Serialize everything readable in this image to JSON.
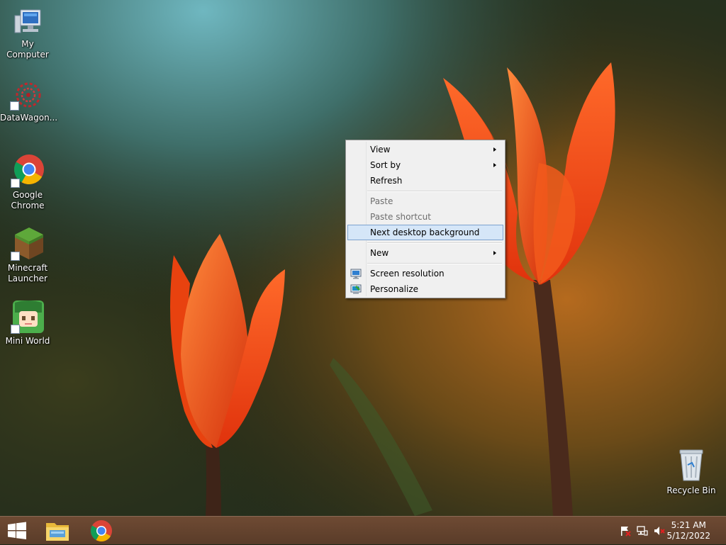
{
  "desktop": {
    "icons": [
      {
        "label": "My Computer",
        "icon": "computer-icon"
      },
      {
        "label": "DataWagon...",
        "icon": "datawagon-icon"
      },
      {
        "label": "Google Chrome",
        "icon": "chrome-icon"
      },
      {
        "label": "Minecraft Launcher",
        "icon": "minecraft-icon"
      },
      {
        "label": "Mini World",
        "icon": "miniworld-icon"
      },
      {
        "label": "Recycle Bin",
        "icon": "recycle-bin-icon"
      }
    ]
  },
  "context_menu": {
    "items": [
      {
        "label": "View",
        "submenu": true,
        "enabled": true
      },
      {
        "label": "Sort by",
        "submenu": true,
        "enabled": true
      },
      {
        "label": "Refresh",
        "submenu": false,
        "enabled": true
      },
      {
        "label": "Paste",
        "submenu": false,
        "enabled": false
      },
      {
        "label": "Paste shortcut",
        "submenu": false,
        "enabled": false
      },
      {
        "label": "Next desktop background",
        "submenu": false,
        "enabled": true,
        "highlighted": true
      },
      {
        "label": "New",
        "submenu": true,
        "enabled": true
      },
      {
        "label": "Screen resolution",
        "submenu": false,
        "enabled": true,
        "icon": "display-icon"
      },
      {
        "label": "Personalize",
        "submenu": false,
        "enabled": true,
        "icon": "personalize-icon"
      }
    ]
  },
  "taskbar": {
    "pinned": [
      "start-icon",
      "file-explorer-icon",
      "chrome-icon"
    ],
    "tray": [
      "action-center-flag-icon",
      "network-icon",
      "volume-muted-icon"
    ],
    "time": "5:21 AM",
    "date": "5/12/2022"
  },
  "colors": {
    "taskbar": "#5e3f2b",
    "menu_bg": "#f0f0f0",
    "menu_highlight": "#d5e6f8",
    "menu_highlight_border": "#7da2ce"
  }
}
